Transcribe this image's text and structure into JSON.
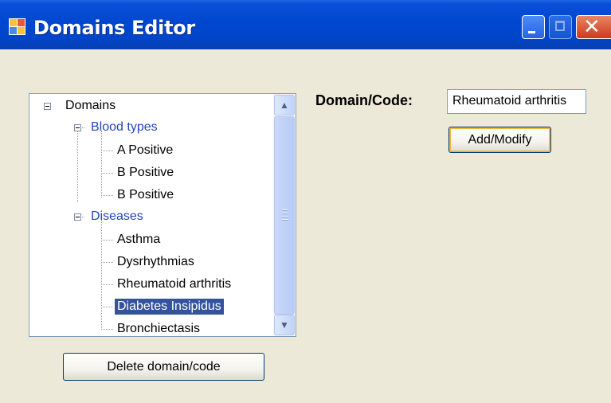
{
  "window": {
    "title": "Domains Editor",
    "icon": "app-window-icon",
    "controls": [
      "minimize-icon",
      "maximize-icon",
      "close-icon"
    ]
  },
  "tree": {
    "root": {
      "label": "Domains",
      "expanded": true
    },
    "categories": [
      {
        "label": "Blood types",
        "expanded": true,
        "items": [
          "A Positive",
          "B Positive",
          "B Positive"
        ]
      },
      {
        "label": "Diseases",
        "expanded": true,
        "items": [
          "Asthma",
          "Dysrhythmias",
          "Rheumatoid arthritis",
          "Diabetes Insipidus",
          "Bronchiectasis"
        ]
      }
    ],
    "selected": "Diabetes Insipidus",
    "colors": {
      "category": "#2446b8",
      "selection": "#33539d"
    }
  },
  "form": {
    "label": "Domain/Code:",
    "value": "Rheumatoid arthritis",
    "add_button": "Add/Modify",
    "delete_button": "Delete domain/code"
  }
}
